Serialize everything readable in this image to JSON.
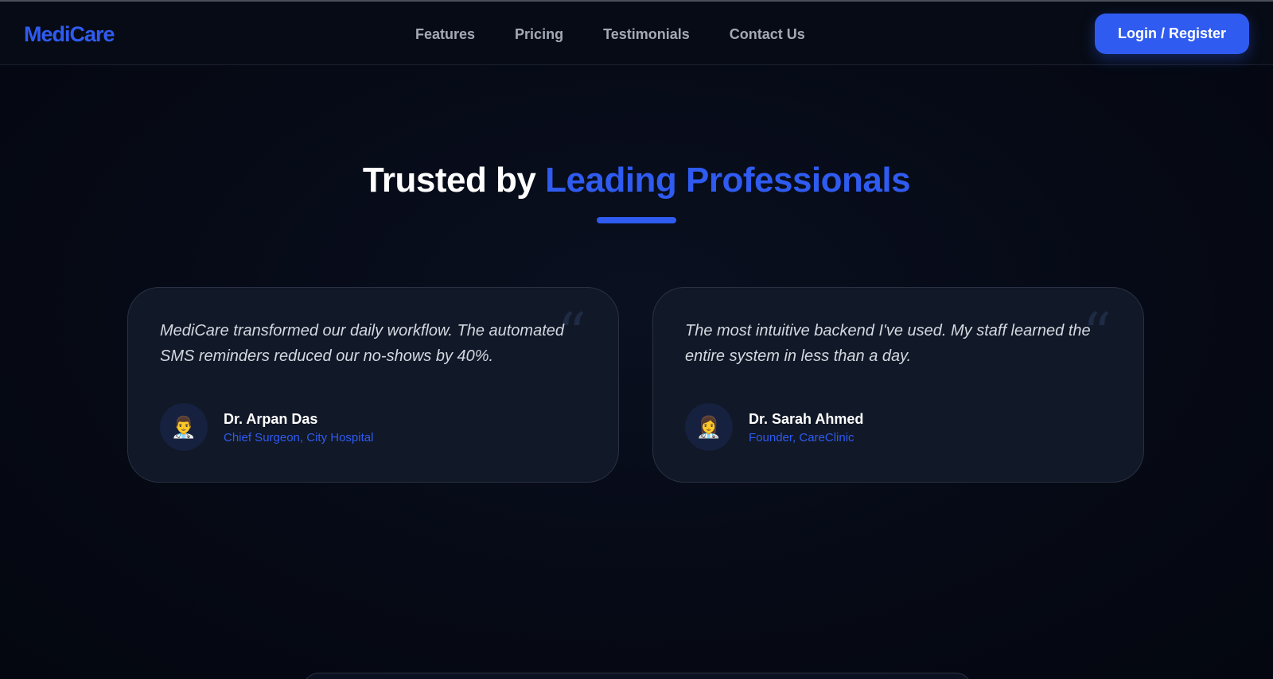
{
  "nav": {
    "logo": "MediCare",
    "links": [
      "Features",
      "Pricing",
      "Testimonials",
      "Contact Us"
    ],
    "login_label": "Login / Register"
  },
  "hero": {
    "title_prefix": "Trusted by ",
    "title_accent": "Leading Professionals"
  },
  "testimonials": [
    {
      "quote": "MediCare transformed our daily workflow. The automated SMS reminders reduced our no-shows by 40%.",
      "avatar_emoji": "👨‍⚕️",
      "name": "Dr. Arpan Das",
      "role": "Chief Surgeon, City Hospital"
    },
    {
      "quote": "The most intuitive backend I've used. My staff learned the entire system in less than a day.",
      "avatar_emoji": "👩‍⚕️",
      "name": "Dr. Sarah Ahmed",
      "role": "Founder, CareClinic"
    }
  ],
  "quote_glyph": "“",
  "colors": {
    "accent": "#2f5bf0",
    "background": "#050914",
    "card": "#111827"
  }
}
